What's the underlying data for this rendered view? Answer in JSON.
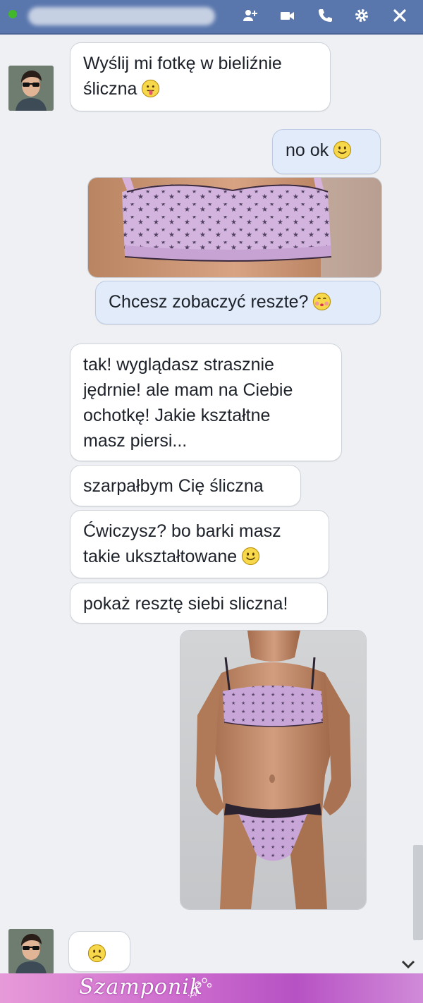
{
  "header": {
    "contact_name": "",
    "icons": [
      "add-people-icon",
      "video-call-icon",
      "phone-call-icon",
      "settings-icon",
      "close-icon"
    ]
  },
  "messages": [
    {
      "sender": "them",
      "text": "Wyślij mi fotkę w bieliźnie\nśliczna",
      "emoji": "tongue-emoji"
    },
    {
      "sender": "me",
      "text": "no ok",
      "emoji": "smile-emoji"
    },
    {
      "sender": "me",
      "photo": "photo-bra-crop"
    },
    {
      "sender": "me",
      "text": "Chcesz zobaczyć reszte?",
      "emoji": "kiss-emoji"
    },
    {
      "sender": "them",
      "text": "tak! wyglądasz strasznie\njędrnie! ale mam na Ciebie\nochotkę! Jakie kształtne\nmasz piersi..."
    },
    {
      "sender": "them",
      "text": "szarpałbym Cię śliczna"
    },
    {
      "sender": "them",
      "text": "Ćwiczysz? bo barki masz\ntakie ukształtowane",
      "emoji": "smile-emoji"
    },
    {
      "sender": "them",
      "text": "pokaż resztę siebi sliczna!"
    },
    {
      "sender": "me",
      "photo": "photo-full-lingerie"
    },
    {
      "sender": "them",
      "emoji": "frown-emoji"
    }
  ],
  "footer": {
    "brand": "Szamponik",
    "tld": ".pl"
  },
  "colors": {
    "header": "#5a77ad",
    "my_bubble": "#e1ebfa",
    "their_bubble": "#ffffff",
    "background": "#eef0f3",
    "footer": "#cf6fcf"
  }
}
